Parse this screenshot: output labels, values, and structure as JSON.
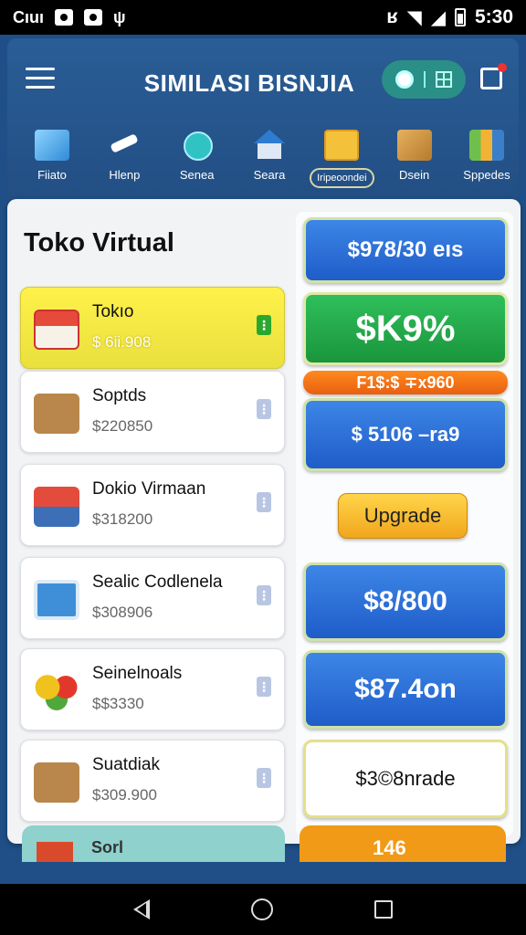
{
  "status_bar": {
    "carrier": "Cıuı",
    "time": "5:30"
  },
  "header": {
    "title": "SIMILASI BISNJIA"
  },
  "categories": [
    {
      "label": "Fiiato",
      "icon": "mail-icon"
    },
    {
      "label": "Hlenp",
      "icon": "plane-icon"
    },
    {
      "label": "Senea",
      "icon": "heart-icon"
    },
    {
      "label": "Seara",
      "icon": "house-icon"
    },
    {
      "label": "Iripeoondei",
      "icon": "toolbox-icon",
      "active": true
    },
    {
      "label": "Dsein",
      "icon": "box-icon"
    },
    {
      "label": "Sppedes",
      "icon": "supplies-icon"
    }
  ],
  "panel": {
    "title": "Toko Virtual"
  },
  "shops": [
    {
      "name": "Tokıo",
      "price": "$ 6ii.908",
      "icon": "store-icon",
      "active": true
    },
    {
      "name": "Soptds",
      "price": "$220850",
      "icon": "shopping-bag-icon"
    },
    {
      "name": "Dokio Virmaan",
      "price": "$318200",
      "icon": "shopping-cart-icon"
    },
    {
      "name": "Sealic Codlenela",
      "price": "$308906",
      "icon": "clipboard-icon"
    },
    {
      "name": "Seinelnoals",
      "price": "$$3330",
      "icon": "fruit-icon"
    },
    {
      "name": "Suatdiak",
      "price": "$309.900",
      "icon": "shopping-bag-icon"
    }
  ],
  "right_panel": {
    "b1": "$978/30 eıs",
    "b2": "$K9%",
    "b3": "F1$:$ ∓x960",
    "b4": "$ 5106 –ra9",
    "upgrade": "Upgrade",
    "b5": "$8/800",
    "b6": "$87.4on",
    "b7": "$3©8nrade"
  },
  "bottom_peek": {
    "left": "Sorl",
    "right": "146"
  },
  "colors": {
    "header_blue": "#224f84",
    "active_yellow": "#fff14a",
    "button_blue": "#1f5cc9",
    "button_green": "#1a953c",
    "orange": "#e85f10"
  }
}
